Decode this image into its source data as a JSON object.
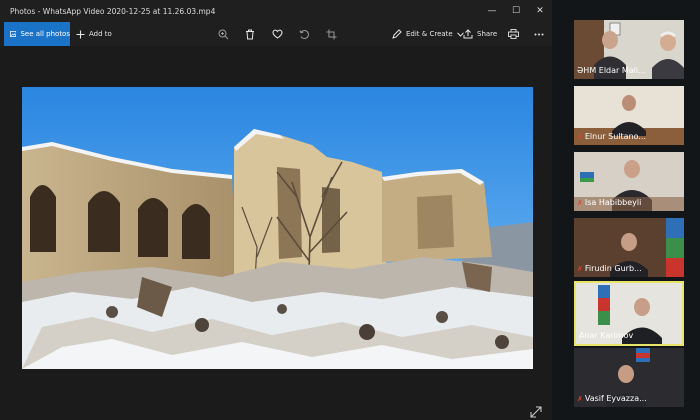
{
  "window": {
    "title": "Photos - WhatsApp Video 2020-12-25 at 11.26.03.mp4",
    "minimize_glyph": "—",
    "maximize_glyph": "☐",
    "close_glyph": "✕"
  },
  "toolbar": {
    "see_all_label": "See all photos",
    "add_to_label": "Add to",
    "edit_create_label": "Edit & Create",
    "share_label": "Share",
    "icons": [
      "zoom-icon",
      "delete-icon",
      "heart-icon",
      "rotate-icon",
      "crop-icon",
      "print-icon",
      "more-icon"
    ]
  },
  "participants": [
    {
      "name": "ƏHM Eldar Məli...",
      "muted": false
    },
    {
      "name": "Elnur Sultano...",
      "muted": true
    },
    {
      "name": "Isa Habibbeyli",
      "muted": true
    },
    {
      "name": "Firudin Gurb...",
      "muted": true
    },
    {
      "name": "Anar Karimov",
      "muted": false
    },
    {
      "name": "Vasif Eyvazza...",
      "muted": true
    }
  ],
  "colors": {
    "accent": "#1b73c8",
    "active_speaker_border": "#e8e46a",
    "muted_icon": "#e0442c"
  }
}
